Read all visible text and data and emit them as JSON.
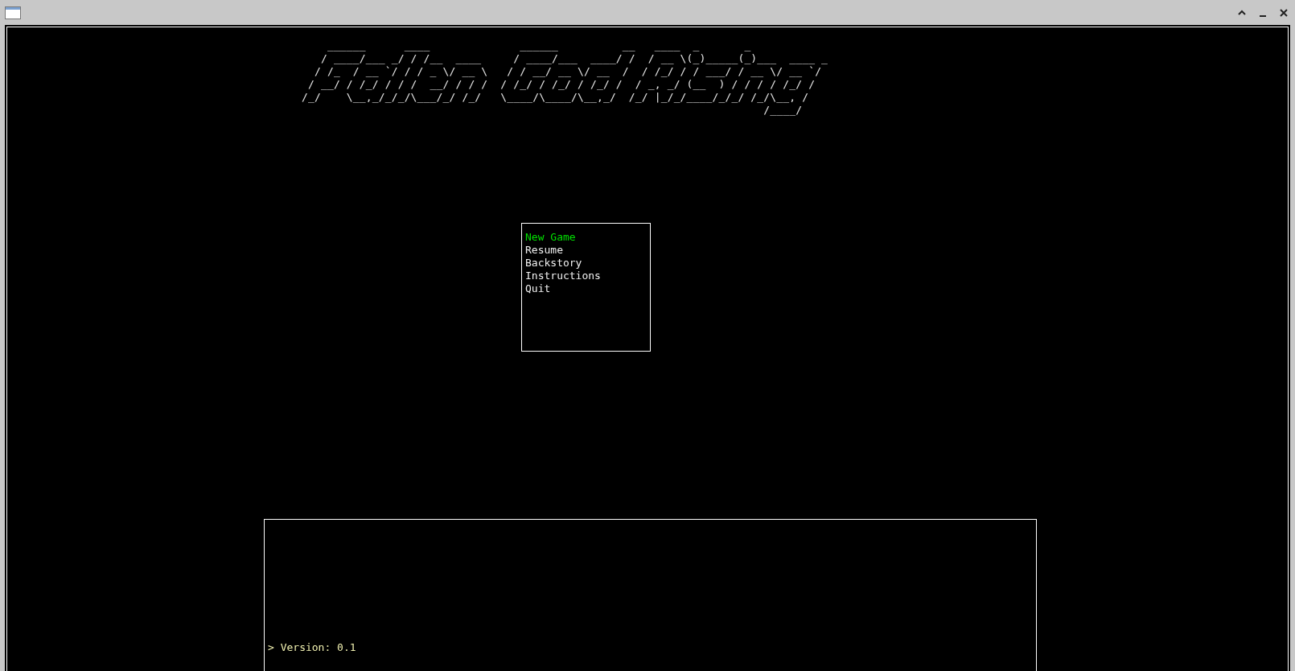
{
  "title_art": [
    "    ______      ____              ______          __   ____  _       _",
    "   / ____/___ _/ / /__  ____     / ____/___  ____/ /  / __ \\(_)_____(_)___  ____ _",
    "  / /_  / __ `/ / / _ \\/ __ \\   / / __/ __ \\/ __  /  / /_/ / / ___/ / __ \\/ __ `/",
    " / __/ / /_/ / / /  __/ / / /  / /_/ / /_/ / /_/ /  / _, _/ (__  ) / / / / /_/ /",
    "/_/    \\__,_/_/_/\\___/_/ /_/   \\____/\\____/\\__,_/  /_/ |_/_/____/_/_/ /_/\\__, /",
    "                                                                        /____/"
  ],
  "menu": [
    {
      "label": "New Game",
      "selected": true
    },
    {
      "label": "Resume",
      "selected": false
    },
    {
      "label": "Backstory",
      "selected": false
    },
    {
      "label": "Instructions",
      "selected": false
    },
    {
      "label": "Quit",
      "selected": false
    }
  ],
  "log": [
    "> Version: 0.1"
  ]
}
